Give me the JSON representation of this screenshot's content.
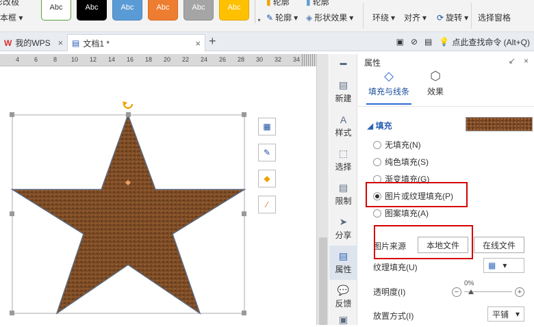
{
  "ribbon": {
    "left_line1": "影改极",
    "left_line2": "本框",
    "left_line2_arrow": "▾",
    "swatches": [
      {
        "label": "Abc",
        "bg": "#ffffff",
        "fg": "#333333",
        "border": "#5aa03c"
      },
      {
        "label": "Abc",
        "bg": "#000000",
        "fg": "#ffffff",
        "border": "#000000"
      },
      {
        "label": "Abc",
        "bg": "#5b9bd5",
        "fg": "#ffffff",
        "border": "#4a86bd"
      },
      {
        "label": "Abc",
        "bg": "#ed7d31",
        "fg": "#ffffff",
        "border": "#d26a22"
      },
      {
        "label": "Abc",
        "bg": "#a5a5a5",
        "fg": "#ffffff",
        "border": "#8e8e8e"
      },
      {
        "label": "Abc",
        "bg": "#ffc000",
        "fg": "#ffffff",
        "border": "#e0a800"
      }
    ],
    "swatch_scroll": "▾",
    "outline_label": "轮廓",
    "outline_arrow": "▾",
    "effect_label": "形状效果",
    "effect_arrow": "▾",
    "partial_label1": "轮廓",
    "partial_label2": "轮廓",
    "wrap_label": "环绕",
    "align_label": "对齐",
    "rotate_label": "旋转",
    "selection_pane_label": "选择窗格",
    "arrow": "▾"
  },
  "tabs": {
    "items": [
      {
        "label": "我的WPS",
        "icon": "W"
      },
      {
        "label": "文档1 *",
        "icon": "▤"
      }
    ],
    "close": "×",
    "add": "+",
    "search_command": "点此查找命令 (Alt+Q)"
  },
  "ruler": {
    "ticks": [
      "4",
      "6",
      "8",
      "10",
      "12",
      "14",
      "16",
      "18",
      "20",
      "22",
      "24",
      "26",
      "28",
      "30",
      "32",
      "34"
    ]
  },
  "sidebar": {
    "items": [
      {
        "label": "新建",
        "icon": "▤"
      },
      {
        "label": "样式",
        "icon": "A"
      },
      {
        "label": "选择",
        "icon": "⬚"
      },
      {
        "label": "限制",
        "icon": "▤"
      },
      {
        "label": "分享",
        "icon": "➤"
      },
      {
        "label": "属性",
        "icon": "▤"
      },
      {
        "label": "反馈",
        "icon": "💬"
      }
    ]
  },
  "panel": {
    "title": "属性",
    "ctrl_pin": "↙",
    "ctrl_close": "×",
    "tab_fill": "填充与线条",
    "tab_effect": "效果",
    "fill_header": "◢ 填充",
    "radios": [
      {
        "label": "无填充(N)",
        "checked": false
      },
      {
        "label": "纯色填充(S)",
        "checked": false
      },
      {
        "label": "渐变填充(G)",
        "checked": false
      },
      {
        "label": "图片或纹理填充(P)",
        "checked": true
      },
      {
        "label": "图案填充(A)",
        "checked": false
      }
    ],
    "picture_source_label": "图片来源",
    "local_file_button": "本地文件",
    "online_file_button": "在线文件",
    "texture_label": "纹理填充(U)",
    "texture_arrow": "▾",
    "transparency_label": "透明度(I)",
    "transparency_value": "0%",
    "minus": "−",
    "plus": "+",
    "placement_label": "放置方式(I)",
    "placement_value": "平铺",
    "placement_arrow": "▾"
  },
  "colors": {
    "accent": "#2b6ad2",
    "highlight_box": "#d40000",
    "star_fill": "#7a4a24",
    "star_stroke": "#5a6a80"
  }
}
